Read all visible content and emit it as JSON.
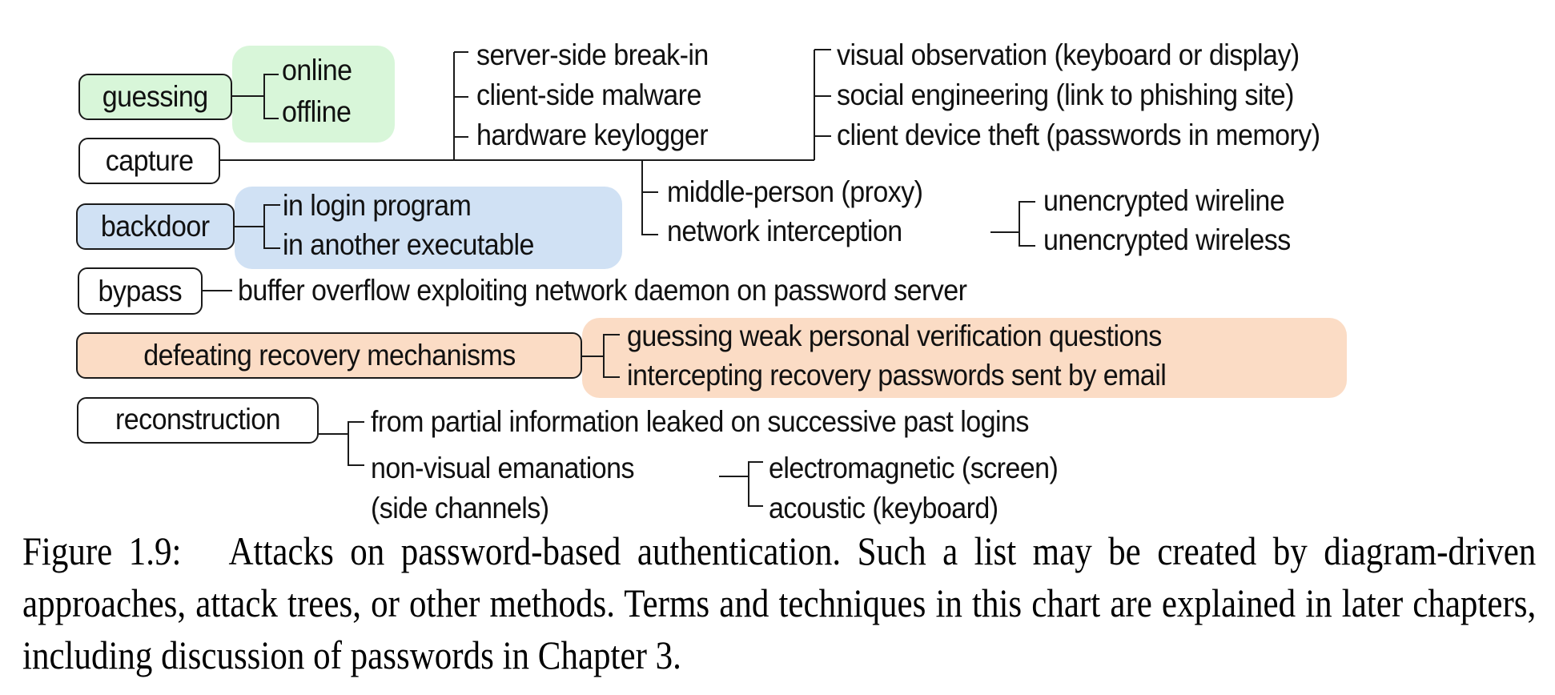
{
  "figure": {
    "title": "Attacks on password-based authentication",
    "roots": [
      {
        "label": "guessing",
        "group_color": "#d8f6d9",
        "children": [
          "online",
          "offline"
        ]
      },
      {
        "label": "capture",
        "children": [
          "server-side break-in",
          "client-side malware",
          "hardware keylogger",
          "visual observation (keyboard or display)",
          "social engineering (link to phishing site)",
          "client device theft (passwords in memory)",
          "middle-person (proxy)",
          "network interception"
        ],
        "network_interception_children": [
          "unencrypted wireline",
          "unencrypted wireless"
        ]
      },
      {
        "label": "backdoor",
        "group_color": "#d0e1f4",
        "children": [
          "in login program",
          "in another executable"
        ]
      },
      {
        "label": "bypass",
        "children": [
          "buffer overflow exploiting network daemon on password server"
        ]
      },
      {
        "label": "defeating recovery mechanisms",
        "group_color": "#fbdcc5",
        "children": [
          "guessing weak personal verification questions",
          "intercepting recovery passwords sent by email"
        ]
      },
      {
        "label": "reconstruction",
        "children": [
          "from partial information leaked on successive past logins",
          "non-visual emanations",
          "(side channels)"
        ],
        "emanation_children": [
          "electromagnetic (screen)",
          "acoustic (keyboard)"
        ]
      }
    ]
  },
  "caption": {
    "label": "Figure 1.9:",
    "text": "Attacks on password-based authentication.  Such a list may be created by diagram-driven approaches, attack trees, or other methods. Terms and techniques in this chart are explained in later chapters, including discussion of passwords in Chapter 3."
  }
}
